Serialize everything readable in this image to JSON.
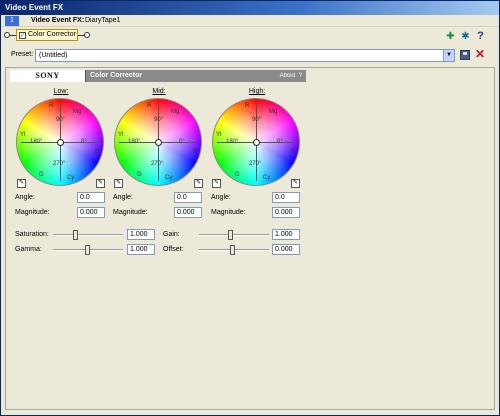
{
  "window": {
    "title": "Video Event FX"
  },
  "header": {
    "number": "1",
    "fx_label": "Video Event FX:",
    "fx_name": "DiaryTape1"
  },
  "chain": {
    "plugin_label": "Color Corrector",
    "checked": "✓"
  },
  "toolbar": {
    "icons": [
      "add-plugin-icon",
      "remove-plugin-icon",
      "help-icon"
    ],
    "help_glyph": "?"
  },
  "preset": {
    "label": "Preset:",
    "value": "(Untitled)"
  },
  "banner": {
    "brand": "SONY",
    "plugin_title": "Color Corrector",
    "about": "About",
    "about_q": "?"
  },
  "wheels": [
    {
      "title": "Low:",
      "angle_label": "Angle:",
      "angle": "0.0",
      "magnitude_label": "Magnitude:",
      "magnitude": "0.000"
    },
    {
      "title": "Mid:",
      "angle_label": "Angle:",
      "angle": "0.0",
      "magnitude_label": "Magnitude:",
      "magnitude": "0.000"
    },
    {
      "title": "High:",
      "angle_label": "Angle:",
      "angle": "0.0",
      "magnitude_label": "Magnitude:",
      "magnitude": "0.000"
    }
  ],
  "wheel_labels": {
    "r": "R",
    "mg": "Mg",
    "b": "B",
    "cy": "Cy",
    "g": "G",
    "yl": "Yl",
    "deg90": "90°",
    "deg180": "180°",
    "deg0": "0°",
    "deg270": "270°"
  },
  "sliders": {
    "saturation": {
      "label": "Saturation:",
      "value": "1.000"
    },
    "gamma": {
      "label": "Gamma:",
      "value": "1.000"
    },
    "gain": {
      "label": "Gain:",
      "value": "1.000"
    },
    "offset": {
      "label": "Offset:",
      "value": "0.000"
    }
  }
}
